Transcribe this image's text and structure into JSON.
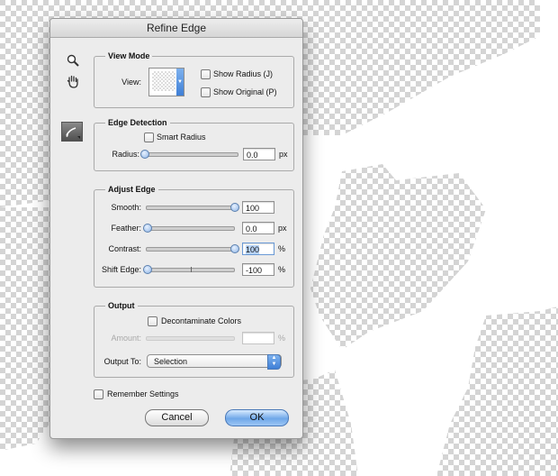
{
  "dialog": {
    "title": "Refine Edge",
    "tools": [
      "zoom-tool",
      "hand-tool",
      "refine-radius-tool"
    ]
  },
  "view_mode": {
    "legend": "View Mode",
    "view_label": "View:",
    "show_radius": {
      "label": "Show Radius (J)",
      "checked": false
    },
    "show_original": {
      "label": "Show Original (P)",
      "checked": false
    }
  },
  "edge_detection": {
    "legend": "Edge Detection",
    "smart_radius": {
      "label": "Smart Radius",
      "checked": false
    },
    "radius": {
      "label": "Radius:",
      "value": "0.0",
      "unit": "px",
      "level": 0.0
    }
  },
  "adjust_edge": {
    "legend": "Adjust Edge",
    "smooth": {
      "label": "Smooth:",
      "value": "100",
      "unit": "",
      "level": 1.0
    },
    "feather": {
      "label": "Feather:",
      "value": "0.0",
      "unit": "px",
      "level": 0.0
    },
    "contrast": {
      "label": "Contrast:",
      "value": "100",
      "unit": "%",
      "level": 1.0
    },
    "shift_edge": {
      "label": "Shift Edge:",
      "value": "-100",
      "unit": "%",
      "level": 0.0
    }
  },
  "output": {
    "legend": "Output",
    "decontaminate": {
      "label": "Decontaminate Colors",
      "checked": false
    },
    "amount": {
      "label": "Amount:",
      "value": "",
      "unit": "%",
      "disabled": true
    },
    "output_to": {
      "label": "Output To:",
      "selected": "Selection"
    }
  },
  "remember_settings": {
    "label": "Remember Settings",
    "checked": false
  },
  "buttons": {
    "cancel": "Cancel",
    "ok": "OK"
  },
  "colors": {
    "accent": "#6fa7e8",
    "dialog_bg": "#ececec"
  }
}
